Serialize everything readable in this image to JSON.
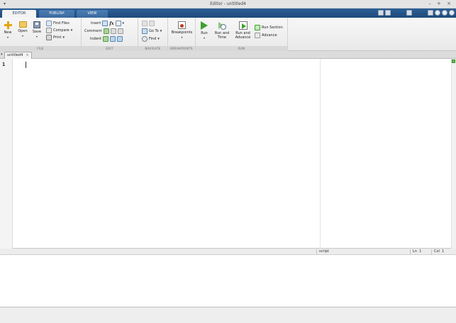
{
  "window": {
    "title": "Editor - untitled4",
    "menu_glyph": "▾",
    "controls": "– + ×"
  },
  "ribbon_tabs": [
    {
      "label": "EDITOR",
      "active": true
    },
    {
      "label": "PUBLISH",
      "active": false
    },
    {
      "label": "VIEW",
      "active": false
    }
  ],
  "file_group": {
    "label": "FILE",
    "new": "New",
    "open": "Open",
    "save": "Save",
    "find_files": "Find Files",
    "compare": "Compare",
    "print": "Print"
  },
  "edit_group": {
    "label": "EDIT",
    "insert": "Insert",
    "comment": "Comment",
    "indent": "Indent",
    "fx": "fx"
  },
  "navigate_group": {
    "label": "NAVIGATE",
    "goto": "Go To",
    "find": "Find"
  },
  "breakpoints_group": {
    "label": "BREAKPOINTS",
    "breakpoints": "Breakpoints"
  },
  "run_group": {
    "label": "RUN",
    "run": "Run",
    "run_and_time_1": "Run and",
    "run_and_time_2": "Time",
    "run_and_advance_1": "Run and",
    "run_and_advance_2": "Advance",
    "run_section": "Run Section",
    "advance": "Advance"
  },
  "document_tab": {
    "label": "untitled4",
    "close": "×",
    "menu_glyph": "▾"
  },
  "editor": {
    "line_number": "1"
  },
  "status": {
    "mode": "script",
    "ln_label": "Ln",
    "ln_value": "1",
    "col_label": "Col",
    "col_value": "1"
  },
  "colors": {
    "ribbon_tab_bar": "#1e4a7a",
    "run_green": "#3ea12e",
    "accent_orange": "#e5a50a"
  }
}
